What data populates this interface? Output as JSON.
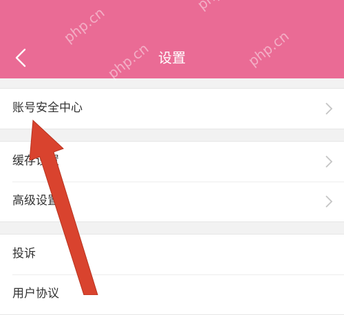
{
  "header": {
    "title": "设置",
    "watermark": "php.cn",
    "background": "#ea6b95",
    "back_icon": "chevron-left-icon"
  },
  "groups": [
    {
      "items": [
        {
          "label": "账号安全中心",
          "icon": "chevron-right-icon"
        }
      ]
    },
    {
      "items": [
        {
          "label": "缓存设置",
          "icon": "chevron-right-icon"
        },
        {
          "label": "高级设置",
          "icon": "chevron-right-icon"
        }
      ]
    },
    {
      "items": [
        {
          "label": "投诉"
        },
        {
          "label": "用户协议"
        }
      ]
    }
  ],
  "annotation": {
    "color": "#d9432e",
    "icon": "red-arrow-annotation"
  }
}
